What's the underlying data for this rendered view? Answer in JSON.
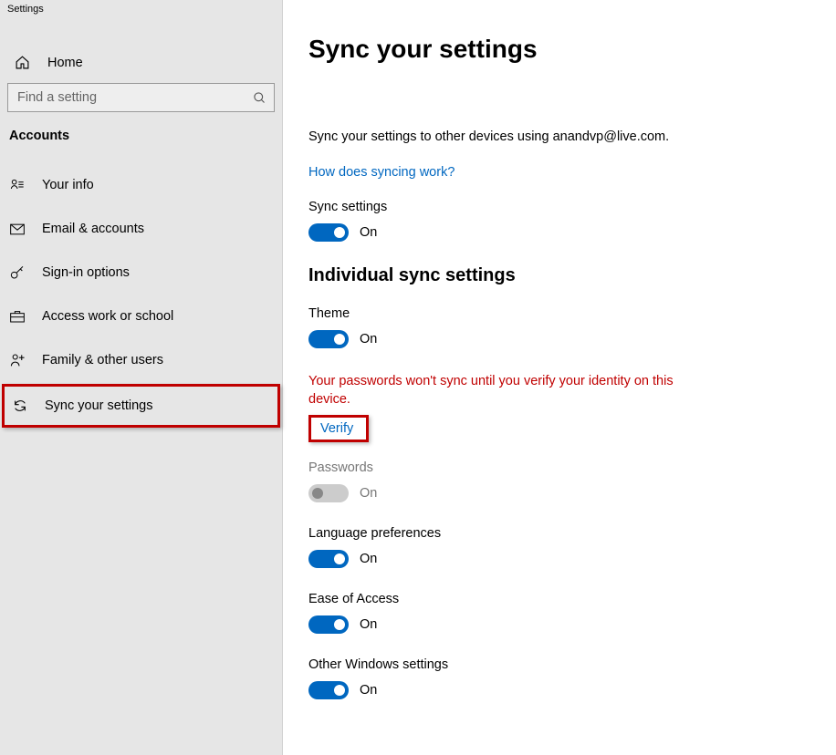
{
  "window_title": "Settings",
  "sidebar": {
    "home_label": "Home",
    "search_placeholder": "Find a setting",
    "section": "Accounts",
    "items": [
      {
        "label": "Your info"
      },
      {
        "label": "Email & accounts"
      },
      {
        "label": "Sign-in options"
      },
      {
        "label": "Access work or school"
      },
      {
        "label": "Family & other users"
      },
      {
        "label": "Sync your settings"
      }
    ]
  },
  "main": {
    "title": "Sync your settings",
    "description": "Sync your settings to other devices using anandvp@live.com.",
    "help_link": "How does syncing work?",
    "sync_settings_label": "Sync settings",
    "sync_settings_state": "On",
    "individual_heading": "Individual sync settings",
    "theme_label": "Theme",
    "theme_state": "On",
    "warning": "Your passwords won't sync until you verify your identity on this device.",
    "verify_label": "Verify",
    "passwords_label": "Passwords",
    "passwords_state": "On",
    "lang_label": "Language preferences",
    "lang_state": "On",
    "ease_label": "Ease of Access",
    "ease_state": "On",
    "other_label": "Other Windows settings",
    "other_state": "On"
  }
}
